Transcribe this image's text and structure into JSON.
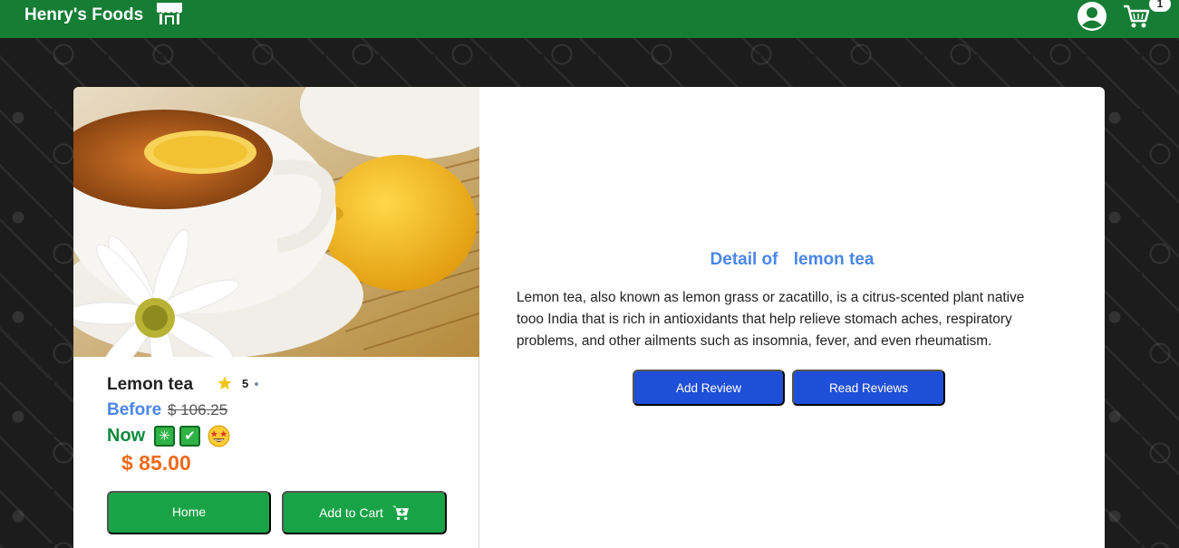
{
  "navbar": {
    "brand": "Henry's Foods",
    "cart_count": "1"
  },
  "product": {
    "name": "Lemon tea",
    "rating": "5",
    "before_label": "Before",
    "before_price": "$ 106.25",
    "now_label": "Now",
    "now_price": "$ 85.00",
    "badges": [
      "✳",
      "✔"
    ]
  },
  "actions": {
    "home_label": "Home",
    "add_to_cart_label": "Add to Cart"
  },
  "detail": {
    "title_prefix": "Detail of",
    "title_name": "lemon tea",
    "description": "Lemon tea, also known as lemon grass or zacatillo, is a citrus-scented plant native tooo India that is rich in antioxidants that help relieve stomach aches, respiratory problems, and other ailments such as insomnia, fever, and even rheumatism.",
    "add_review_label": "Add Review",
    "read_reviews_label": "Read Reviews"
  },
  "colors": {
    "navbar": "#157d34",
    "primary_blue": "#1f4fd8",
    "action_green": "#18a346",
    "price_orange": "#ee6a1a",
    "accent_blue": "#4a86e8"
  },
  "icons": {
    "store": "store-icon",
    "user": "user-circle-icon",
    "cart": "shopping-cart-icon",
    "star": "star-icon",
    "face": "star-struck-emoji-icon"
  }
}
